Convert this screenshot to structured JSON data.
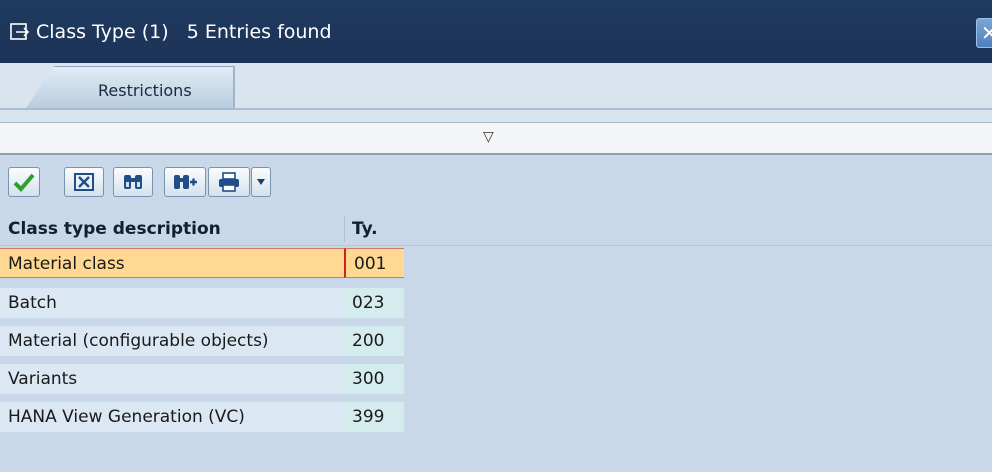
{
  "dialog": {
    "title": "Class Type (1)   5 Entries found"
  },
  "tabs": [
    {
      "label": "Restrictions"
    }
  ],
  "toolbar": {
    "buttons": [
      {
        "icon": "checkmark-icon"
      },
      {
        "icon": "cancel-icon"
      },
      {
        "icon": "find-icon"
      },
      {
        "icon": "find-next-icon"
      },
      {
        "icon": "print-icon"
      }
    ]
  },
  "table": {
    "headers": [
      "Class type description",
      "Ty."
    ],
    "rows": [
      {
        "description": "Material class",
        "type": "001",
        "selected": true
      },
      {
        "description": "Batch",
        "type": "023"
      },
      {
        "description": "Material (configurable objects)",
        "type": "200"
      },
      {
        "description": "Variants",
        "type": "300"
      },
      {
        "description": "HANA View Generation (VC)",
        "type": "399"
      }
    ]
  },
  "colors": {
    "titlebar": "#1b3356",
    "background": "#c8d8e8",
    "selected_row": "#ffd992",
    "check_green": "#2e9e2e"
  }
}
